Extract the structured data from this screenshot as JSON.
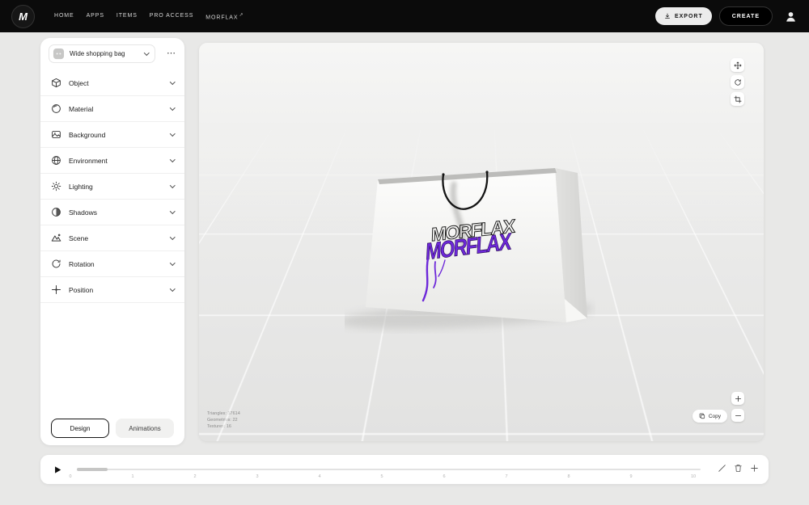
{
  "topbar": {
    "logo_text": "M",
    "nav": [
      {
        "label": "HOME"
      },
      {
        "label": "APPS"
      },
      {
        "label": "ITEMS"
      },
      {
        "label": "PRO ACCESS"
      },
      {
        "label": "MORFLAX"
      }
    ],
    "external_icon": "↗",
    "export_label": "EXPORT",
    "create_label": "CREATE"
  },
  "sidebar": {
    "preset_label": "Wide shopping bag",
    "menu_dots": "⋯",
    "sections": [
      {
        "label": "Object"
      },
      {
        "label": "Material"
      },
      {
        "label": "Background"
      },
      {
        "label": "Environment"
      },
      {
        "label": "Lighting"
      },
      {
        "label": "Shadows"
      },
      {
        "label": "Scene"
      },
      {
        "label": "Rotation"
      },
      {
        "label": "Position"
      }
    ],
    "design_label": "Design",
    "animations_label": "Animations"
  },
  "viewport": {
    "logo_text": "MORFLAX",
    "stats": [
      "Triangles: 37614",
      "Geometries: 22",
      "Textures: 16"
    ],
    "copy_label": "Copy"
  },
  "timeline": {
    "ticks": [
      "0",
      "1",
      "2",
      "3",
      "4",
      "5",
      "6",
      "7",
      "8",
      "9",
      "10"
    ]
  },
  "colors": {
    "accent_purple": "#6d28d9",
    "topbar_bg": "#0b0b0b"
  }
}
